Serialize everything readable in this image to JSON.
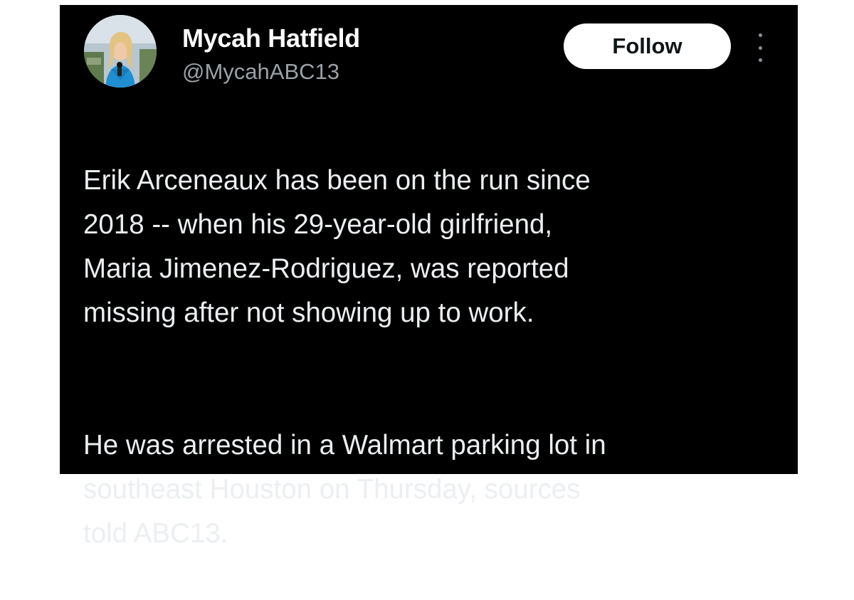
{
  "tweet": {
    "author": {
      "display_name": "Mycah Hatfield",
      "handle": "@MycahABC13"
    },
    "follow_label": "Follow",
    "more_icon": "more-vertical-icon",
    "paragraphs": [
      "Erik Arceneaux has been on the run since\n2018 -- when his 29-year-old girlfriend,\nMaria Jimenez-Rodriguez, was reported\nmissing after not showing up to work.",
      "He was arrested in a Walmart parking lot in\nsoutheast Houston on Thursday, sources\ntold ABC13."
    ]
  },
  "colors": {
    "background": "#000000",
    "primary_text": "#e7e9ea",
    "secondary_text": "#9aa1a7",
    "follow_button_bg": "#ffffff",
    "follow_button_text": "#0f1419"
  }
}
